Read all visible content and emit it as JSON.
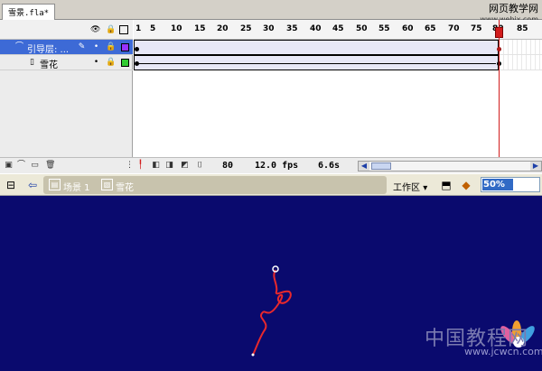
{
  "document": {
    "tab_label": "雪景.fla*",
    "watermark_top": "网页教学网",
    "watermark_top_url": "www.webjx.com"
  },
  "timeline": {
    "layers": [
      {
        "name": "引导层: ...",
        "selected": true,
        "color": "#9933ff"
      },
      {
        "name": "雪花",
        "selected": false,
        "color": "#33cc33"
      }
    ],
    "ruler": [
      "1",
      "5",
      "10",
      "15",
      "20",
      "25",
      "30",
      "35",
      "40",
      "45",
      "50",
      "55",
      "60",
      "65",
      "70",
      "75",
      "80",
      "85"
    ],
    "current_frame": "80",
    "fps": "12.0 fps",
    "time": "6.6s"
  },
  "editbar": {
    "scene": "场景 1",
    "symbol": "雪花",
    "workspace": "工作区",
    "zoom": "50%"
  },
  "stage": {
    "background": "#0a0a6e",
    "watermark_cn": "中国教程网",
    "watermark_url": "www.jcwcn.com"
  },
  "icons": {
    "eye": "eye-icon",
    "lock": "lock-icon",
    "outline": "outline-icon",
    "guide_layer": "guide-layer-icon",
    "layer": "layer-icon",
    "pencil": "pencil-icon",
    "back": "back-arrow-icon",
    "scene": "scene-icon",
    "symbol": "symbol-icon"
  }
}
